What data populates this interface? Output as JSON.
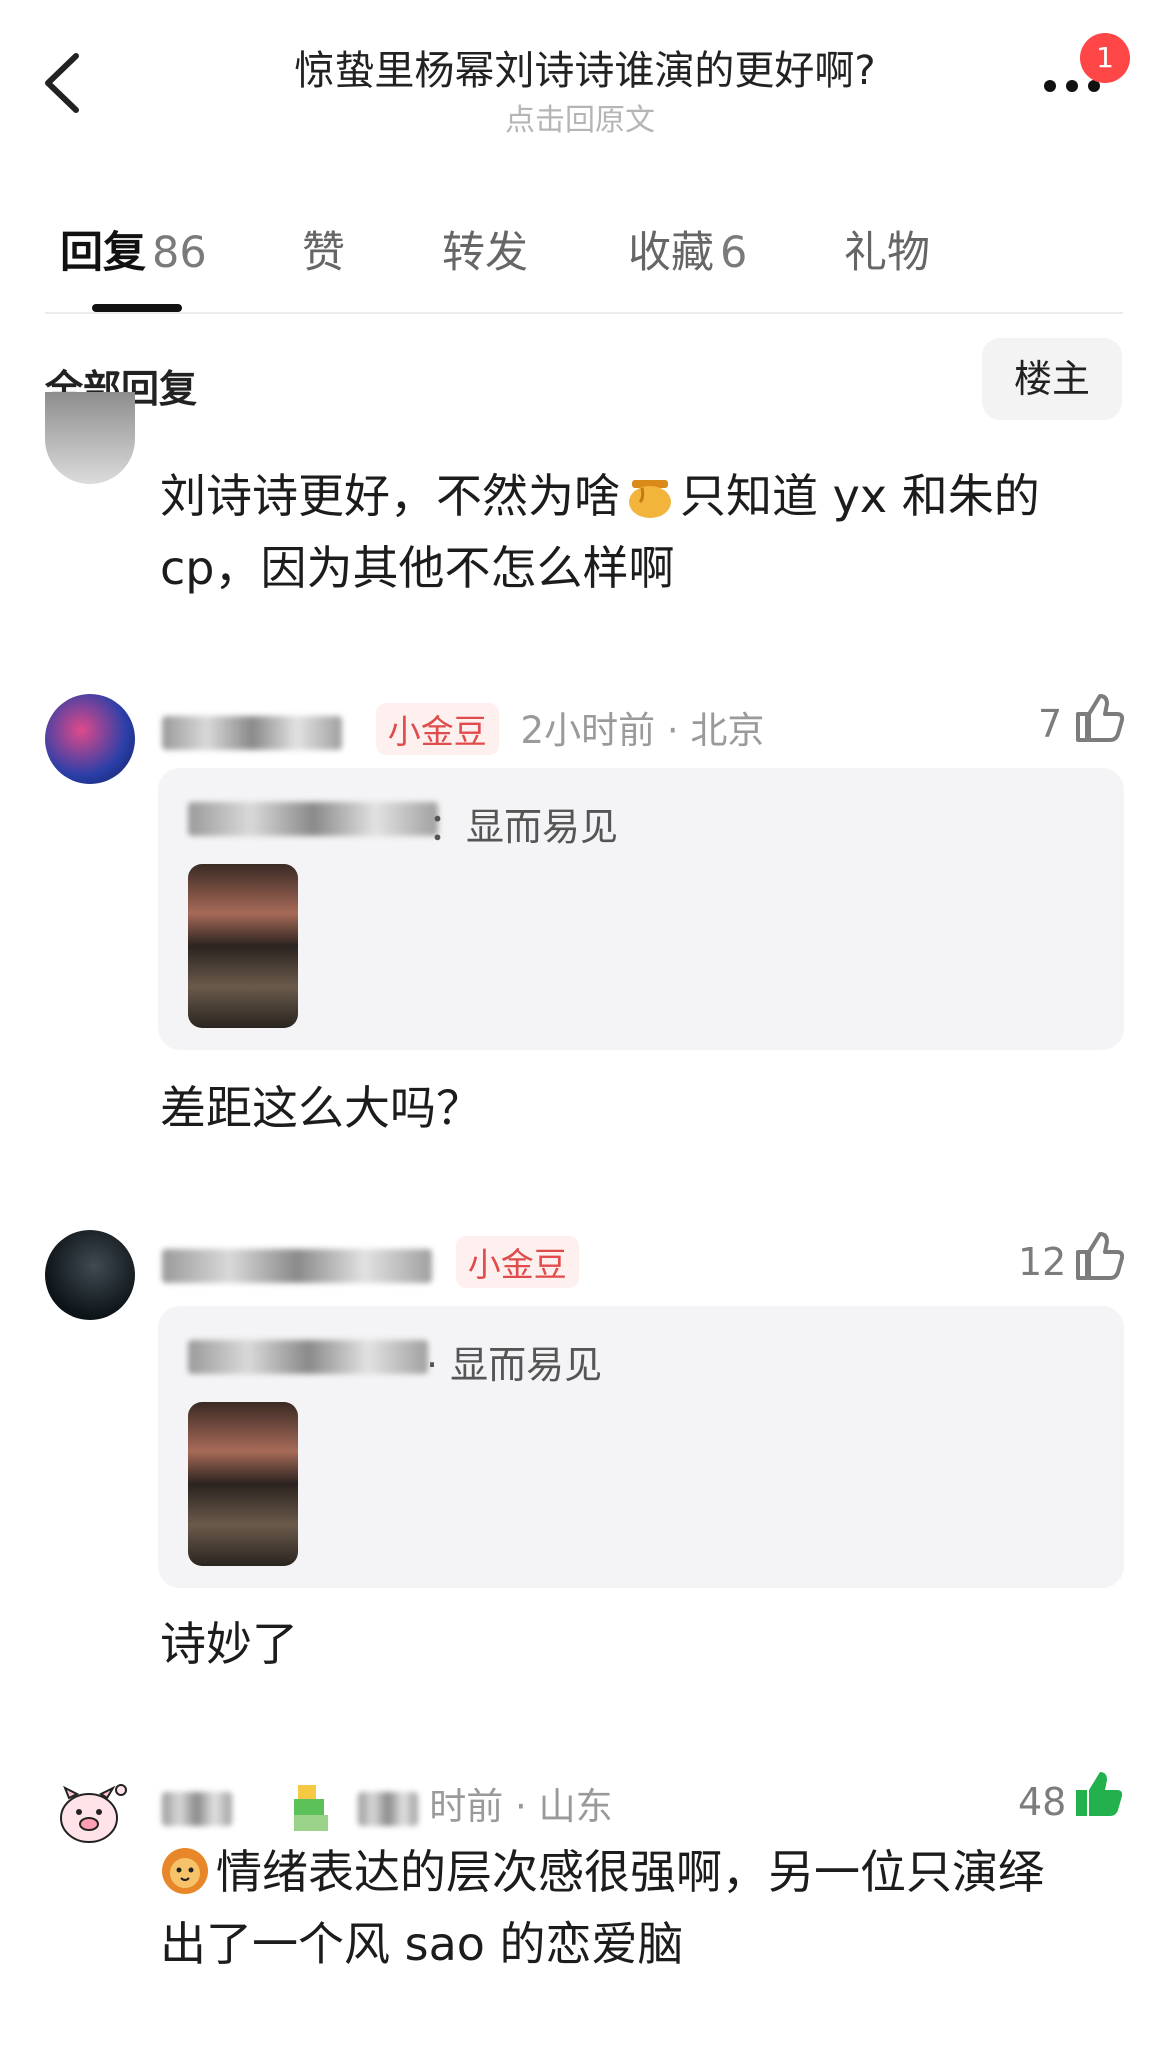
{
  "header": {
    "title": "惊蛰里杨幂刘诗诗谁演的更好啊?",
    "subtitle": "点击回原文",
    "badge_count": "1"
  },
  "tabs": [
    {
      "label": "回复",
      "count": "86"
    },
    {
      "label": "赞",
      "count": ""
    },
    {
      "label": "转发",
      "count": ""
    },
    {
      "label": "收藏",
      "count": "6"
    },
    {
      "label": "礼物",
      "count": ""
    }
  ],
  "section": {
    "all_replies": "全部回复",
    "owner_filter": "楼主"
  },
  "comments": [
    {
      "text_before_emoji": "刘诗诗更好，不然为啥",
      "text_after_emoji": "只知道 yx 和朱的",
      "text_line2": "cp，因为其他不怎么样啊",
      "emoji": "honey-pot-icon"
    },
    {
      "badge": "小金豆",
      "time": "2小时前 · 北京",
      "likes": "7",
      "quote_suffix": "：显而易见",
      "text": "差距这么大吗？"
    },
    {
      "badge": "小金豆",
      "likes": "12",
      "quote_suffix": "· 显而易见",
      "text": "诗妙了"
    },
    {
      "time_suffix": "时前 · 山东",
      "likes": "48",
      "text_line1": "情绪表达的层次感很强啊，另一位只演绎",
      "text_line2": "出了一个风 sao 的恋爱脑",
      "emoji": "lion-icon"
    }
  ],
  "colors": {
    "badge_red": "#ff4646",
    "gold_tag_text": "#e04b4b",
    "like_green": "#22b14c"
  }
}
